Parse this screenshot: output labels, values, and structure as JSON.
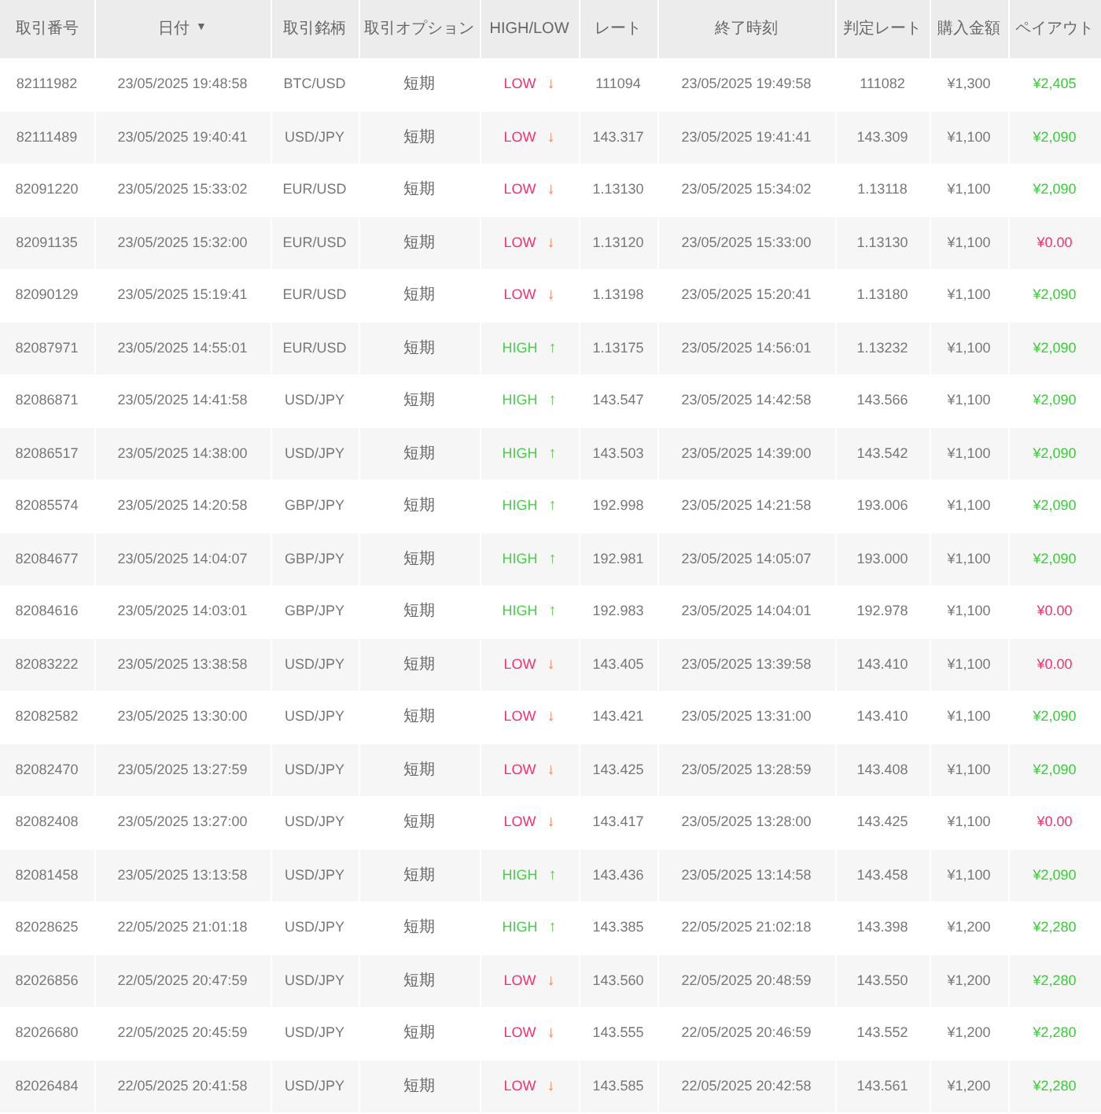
{
  "table": {
    "columns": [
      {
        "label": "取引番号"
      },
      {
        "label": "日付",
        "sort_icon": "▼"
      },
      {
        "label": "取引銘柄"
      },
      {
        "label": "取引オプション"
      },
      {
        "label": "HIGH/LOW"
      },
      {
        "label": "レート"
      },
      {
        "label": "終了時刻"
      },
      {
        "label": "判定レート"
      },
      {
        "label": "購入金額"
      },
      {
        "label": "ペイアウト"
      }
    ],
    "rows": [
      {
        "id": "82111982",
        "date": "23/05/2025 19:48:58",
        "symbol": "BTC/USD",
        "option": "短期",
        "direction": {
          "kind": "low",
          "label": "LOW",
          "arrow": "↓"
        },
        "rate": "111094",
        "end_time": "23/05/2025 19:49:58",
        "judge_rate": "111082",
        "amount": "¥1,300",
        "payout": {
          "kind": "win",
          "text": "¥2,405"
        }
      },
      {
        "id": "82111489",
        "date": "23/05/2025 19:40:41",
        "symbol": "USD/JPY",
        "option": "短期",
        "direction": {
          "kind": "low",
          "label": "LOW",
          "arrow": "↓"
        },
        "rate": "143.317",
        "end_time": "23/05/2025 19:41:41",
        "judge_rate": "143.309",
        "amount": "¥1,100",
        "payout": {
          "kind": "win",
          "text": "¥2,090"
        }
      },
      {
        "id": "82091220",
        "date": "23/05/2025 15:33:02",
        "symbol": "EUR/USD",
        "option": "短期",
        "direction": {
          "kind": "low",
          "label": "LOW",
          "arrow": "↓"
        },
        "rate": "1.13130",
        "end_time": "23/05/2025 15:34:02",
        "judge_rate": "1.13118",
        "amount": "¥1,100",
        "payout": {
          "kind": "win",
          "text": "¥2,090"
        }
      },
      {
        "id": "82091135",
        "date": "23/05/2025 15:32:00",
        "symbol": "EUR/USD",
        "option": "短期",
        "direction": {
          "kind": "low",
          "label": "LOW",
          "arrow": "↓"
        },
        "rate": "1.13120",
        "end_time": "23/05/2025 15:33:00",
        "judge_rate": "1.13130",
        "amount": "¥1,100",
        "payout": {
          "kind": "loss",
          "text": "¥0.00"
        }
      },
      {
        "id": "82090129",
        "date": "23/05/2025 15:19:41",
        "symbol": "EUR/USD",
        "option": "短期",
        "direction": {
          "kind": "low",
          "label": "LOW",
          "arrow": "↓"
        },
        "rate": "1.13198",
        "end_time": "23/05/2025 15:20:41",
        "judge_rate": "1.13180",
        "amount": "¥1,100",
        "payout": {
          "kind": "win",
          "text": "¥2,090"
        }
      },
      {
        "id": "82087971",
        "date": "23/05/2025 14:55:01",
        "symbol": "EUR/USD",
        "option": "短期",
        "direction": {
          "kind": "high",
          "label": "HIGH",
          "arrow": "↑"
        },
        "rate": "1.13175",
        "end_time": "23/05/2025 14:56:01",
        "judge_rate": "1.13232",
        "amount": "¥1,100",
        "payout": {
          "kind": "win",
          "text": "¥2,090"
        }
      },
      {
        "id": "82086871",
        "date": "23/05/2025 14:41:58",
        "symbol": "USD/JPY",
        "option": "短期",
        "direction": {
          "kind": "high",
          "label": "HIGH",
          "arrow": "↑"
        },
        "rate": "143.547",
        "end_time": "23/05/2025 14:42:58",
        "judge_rate": "143.566",
        "amount": "¥1,100",
        "payout": {
          "kind": "win",
          "text": "¥2,090"
        }
      },
      {
        "id": "82086517",
        "date": "23/05/2025 14:38:00",
        "symbol": "USD/JPY",
        "option": "短期",
        "direction": {
          "kind": "high",
          "label": "HIGH",
          "arrow": "↑"
        },
        "rate": "143.503",
        "end_time": "23/05/2025 14:39:00",
        "judge_rate": "143.542",
        "amount": "¥1,100",
        "payout": {
          "kind": "win",
          "text": "¥2,090"
        }
      },
      {
        "id": "82085574",
        "date": "23/05/2025 14:20:58",
        "symbol": "GBP/JPY",
        "option": "短期",
        "direction": {
          "kind": "high",
          "label": "HIGH",
          "arrow": "↑"
        },
        "rate": "192.998",
        "end_time": "23/05/2025 14:21:58",
        "judge_rate": "193.006",
        "amount": "¥1,100",
        "payout": {
          "kind": "win",
          "text": "¥2,090"
        }
      },
      {
        "id": "82084677",
        "date": "23/05/2025 14:04:07",
        "symbol": "GBP/JPY",
        "option": "短期",
        "direction": {
          "kind": "high",
          "label": "HIGH",
          "arrow": "↑"
        },
        "rate": "192.981",
        "end_time": "23/05/2025 14:05:07",
        "judge_rate": "193.000",
        "amount": "¥1,100",
        "payout": {
          "kind": "win",
          "text": "¥2,090"
        }
      },
      {
        "id": "82084616",
        "date": "23/05/2025 14:03:01",
        "symbol": "GBP/JPY",
        "option": "短期",
        "direction": {
          "kind": "high",
          "label": "HIGH",
          "arrow": "↑"
        },
        "rate": "192.983",
        "end_time": "23/05/2025 14:04:01",
        "judge_rate": "192.978",
        "amount": "¥1,100",
        "payout": {
          "kind": "loss",
          "text": "¥0.00"
        }
      },
      {
        "id": "82083222",
        "date": "23/05/2025 13:38:58",
        "symbol": "USD/JPY",
        "option": "短期",
        "direction": {
          "kind": "low",
          "label": "LOW",
          "arrow": "↓"
        },
        "rate": "143.405",
        "end_time": "23/05/2025 13:39:58",
        "judge_rate": "143.410",
        "amount": "¥1,100",
        "payout": {
          "kind": "loss",
          "text": "¥0.00"
        }
      },
      {
        "id": "82082582",
        "date": "23/05/2025 13:30:00",
        "symbol": "USD/JPY",
        "option": "短期",
        "direction": {
          "kind": "low",
          "label": "LOW",
          "arrow": "↓"
        },
        "rate": "143.421",
        "end_time": "23/05/2025 13:31:00",
        "judge_rate": "143.410",
        "amount": "¥1,100",
        "payout": {
          "kind": "win",
          "text": "¥2,090"
        }
      },
      {
        "id": "82082470",
        "date": "23/05/2025 13:27:59",
        "symbol": "USD/JPY",
        "option": "短期",
        "direction": {
          "kind": "low",
          "label": "LOW",
          "arrow": "↓"
        },
        "rate": "143.425",
        "end_time": "23/05/2025 13:28:59",
        "judge_rate": "143.408",
        "amount": "¥1,100",
        "payout": {
          "kind": "win",
          "text": "¥2,090"
        }
      },
      {
        "id": "82082408",
        "date": "23/05/2025 13:27:00",
        "symbol": "USD/JPY",
        "option": "短期",
        "direction": {
          "kind": "low",
          "label": "LOW",
          "arrow": "↓"
        },
        "rate": "143.417",
        "end_time": "23/05/2025 13:28:00",
        "judge_rate": "143.425",
        "amount": "¥1,100",
        "payout": {
          "kind": "loss",
          "text": "¥0.00"
        }
      },
      {
        "id": "82081458",
        "date": "23/05/2025 13:13:58",
        "symbol": "USD/JPY",
        "option": "短期",
        "direction": {
          "kind": "high",
          "label": "HIGH",
          "arrow": "↑"
        },
        "rate": "143.436",
        "end_time": "23/05/2025 13:14:58",
        "judge_rate": "143.458",
        "amount": "¥1,100",
        "payout": {
          "kind": "win",
          "text": "¥2,090"
        }
      },
      {
        "id": "82028625",
        "date": "22/05/2025 21:01:18",
        "symbol": "USD/JPY",
        "option": "短期",
        "direction": {
          "kind": "high",
          "label": "HIGH",
          "arrow": "↑"
        },
        "rate": "143.385",
        "end_time": "22/05/2025 21:02:18",
        "judge_rate": "143.398",
        "amount": "¥1,200",
        "payout": {
          "kind": "win",
          "text": "¥2,280"
        }
      },
      {
        "id": "82026856",
        "date": "22/05/2025 20:47:59",
        "symbol": "USD/JPY",
        "option": "短期",
        "direction": {
          "kind": "low",
          "label": "LOW",
          "arrow": "↓"
        },
        "rate": "143.560",
        "end_time": "22/05/2025 20:48:59",
        "judge_rate": "143.550",
        "amount": "¥1,200",
        "payout": {
          "kind": "win",
          "text": "¥2,280"
        }
      },
      {
        "id": "82026680",
        "date": "22/05/2025 20:45:59",
        "symbol": "USD/JPY",
        "option": "短期",
        "direction": {
          "kind": "low",
          "label": "LOW",
          "arrow": "↓"
        },
        "rate": "143.555",
        "end_time": "22/05/2025 20:46:59",
        "judge_rate": "143.552",
        "amount": "¥1,200",
        "payout": {
          "kind": "win",
          "text": "¥2,280"
        }
      },
      {
        "id": "82026484",
        "date": "22/05/2025 20:41:58",
        "symbol": "USD/JPY",
        "option": "短期",
        "direction": {
          "kind": "low",
          "label": "LOW",
          "arrow": "↓"
        },
        "rate": "143.585",
        "end_time": "22/05/2025 20:42:58",
        "judge_rate": "143.561",
        "amount": "¥1,200",
        "payout": {
          "kind": "win",
          "text": "¥2,280"
        }
      }
    ]
  }
}
